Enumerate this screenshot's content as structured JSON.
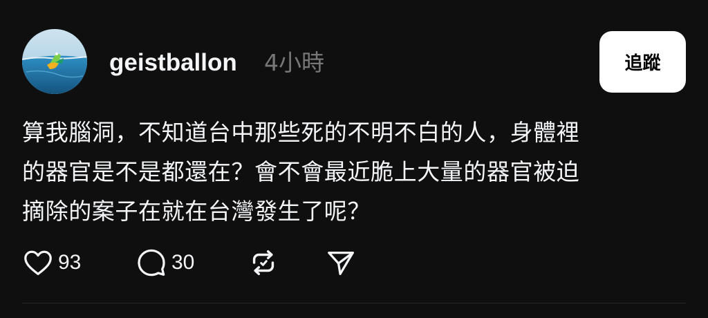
{
  "post": {
    "username": "geistballon",
    "timestamp": "4小時",
    "follow_label": "追蹤",
    "text_lines": [
      "算我腦洞，不知道台中那些死的不明不白的人，身體裡",
      "的器官是不是都還在？會不會最近脆上大量的器官被迫",
      "摘除的案子在就在台灣發生了呢？"
    ]
  },
  "actions": {
    "like": {
      "icon": "heart-icon",
      "count": "93"
    },
    "reply": {
      "icon": "comment-icon",
      "count": "30"
    },
    "repost": {
      "icon": "repost-icon"
    },
    "share": {
      "icon": "send-icon"
    }
  },
  "colors": {
    "background": "#0f0f10",
    "text": "#f3f5f7",
    "muted": "#777777",
    "button_bg": "#ffffff",
    "button_text": "#000000",
    "divider": "#2a2a2a"
  }
}
